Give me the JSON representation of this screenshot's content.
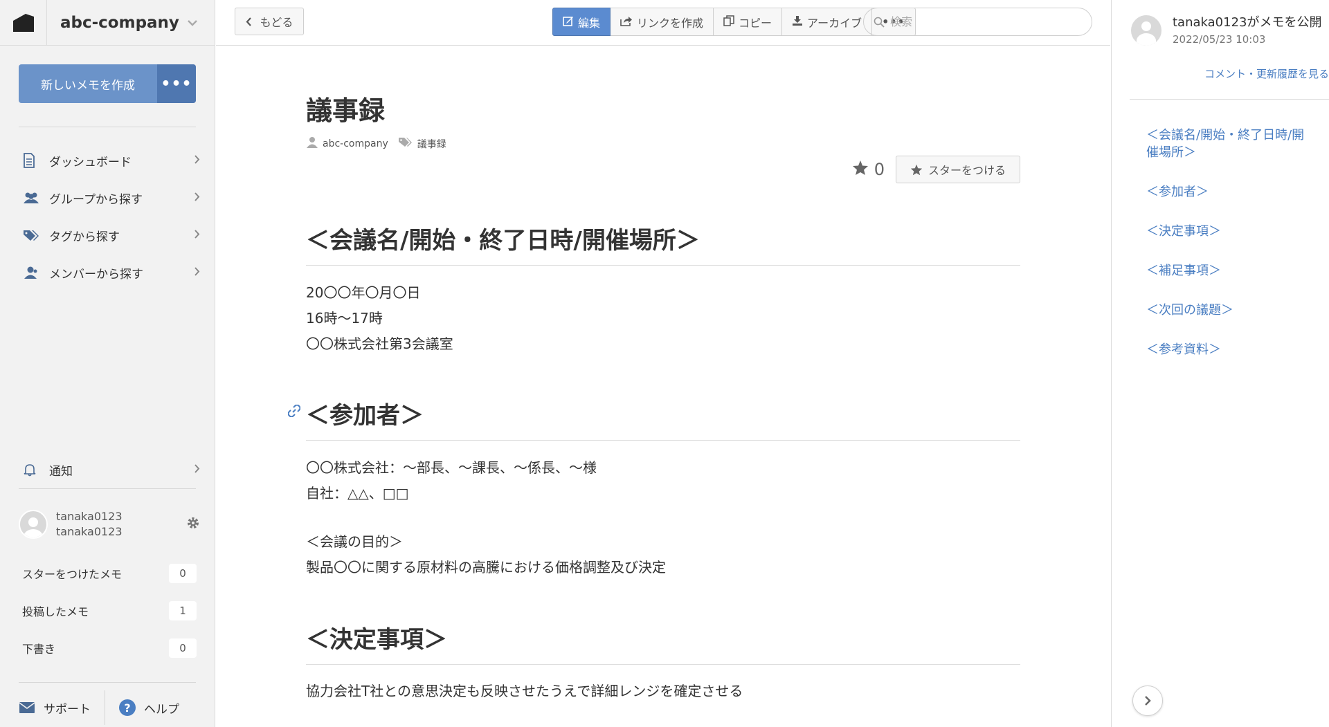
{
  "sidebar": {
    "company_name": "abc-company",
    "new_memo_label": "新しいメモを作成",
    "more_label": "•••",
    "nav": [
      {
        "label": "ダッシュボード",
        "icon": "document-icon"
      },
      {
        "label": "グループから探す",
        "icon": "group-icon"
      },
      {
        "label": "タグから探す",
        "icon": "tag-icon"
      },
      {
        "label": "メンバーから探す",
        "icon": "member-icon"
      }
    ],
    "notification_label": "通知",
    "user": {
      "display_name": "tanaka0123",
      "username": "tanaka0123"
    },
    "stats": [
      {
        "label": "スターをつけたメモ",
        "count": "0"
      },
      {
        "label": "投稿したメモ",
        "count": "1"
      },
      {
        "label": "下書き",
        "count": "0"
      }
    ],
    "support_label": "サポート",
    "help_label": "ヘルプ"
  },
  "toolbar": {
    "back_label": "もどる",
    "edit_label": "編集",
    "link_label": "リンクを作成",
    "copy_label": "コピー",
    "archive_label": "アーカイブ",
    "more_label": "•••",
    "search_placeholder": "検索"
  },
  "doc": {
    "title": "議事録",
    "author": "abc-company",
    "tag": "議事録",
    "star_count": "0",
    "star_button": "スターをつける",
    "sections": [
      {
        "heading": "＜会議名/開始・終了日時/開催場所＞",
        "lines": [
          "20〇〇年〇月〇日",
          "16時〜17時",
          "〇〇株式会社第3会議室"
        ]
      },
      {
        "heading": "＜参加者＞",
        "lines": [
          "〇〇株式会社：〜部長、〜課長、〜係長、〜様",
          "自社：△△、□□",
          "",
          "＜会議の目的＞",
          "製品〇〇に関する原材料の高騰における価格調整及び決定"
        ]
      },
      {
        "heading": "＜決定事項＞",
        "lines": [
          "協力会社T社との意思決定も反映させたうえで詳細レンジを確定させる"
        ]
      }
    ]
  },
  "right_panel": {
    "activity_text": "tanaka0123がメモを公開",
    "activity_time": "2022/05/23 10:03",
    "history_link": "コメント・更新履歴を見る",
    "toc": [
      "＜会議名/開始・終了日時/開催場所＞",
      "＜参加者＞",
      "＜決定事項＞",
      "＜補足事項＞",
      "＜次回の議題＞",
      "＜参考資料＞"
    ]
  },
  "colors": {
    "accent": "#5b8bd0",
    "link": "#4a7ec2",
    "sidebar_bg": "#f2f2f2"
  }
}
